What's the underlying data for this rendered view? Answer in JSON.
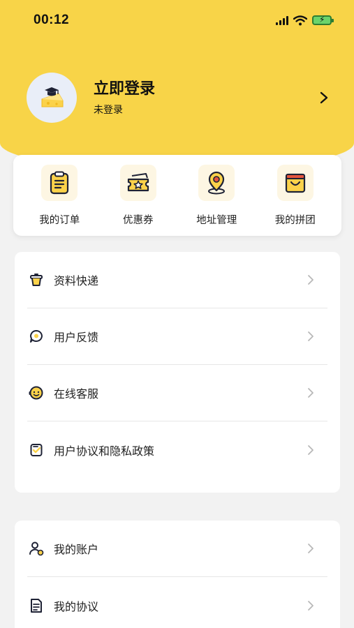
{
  "status_bar": {
    "time": "00:12"
  },
  "profile": {
    "title": "立即登录",
    "subtitle": "未登录"
  },
  "quick_actions": [
    {
      "label": "我的订单",
      "icon": "order-clipboard-icon"
    },
    {
      "label": "优惠券",
      "icon": "coupon-ticket-icon"
    },
    {
      "label": "地址管理",
      "icon": "location-pin-icon"
    },
    {
      "label": "我的拼团",
      "icon": "group-bag-icon"
    }
  ],
  "menu_primary": [
    {
      "label": "资料快递",
      "icon": "cup-icon"
    },
    {
      "label": "用户反馈",
      "icon": "feedback-chat-icon"
    },
    {
      "label": "在线客服",
      "icon": "service-face-icon"
    },
    {
      "label": "用户协议和隐私政策",
      "icon": "agreement-check-icon"
    }
  ],
  "menu_secondary": [
    {
      "label": "我的账户",
      "icon": "account-user-icon"
    },
    {
      "label": "我的协议",
      "icon": "document-icon"
    }
  ],
  "colors": {
    "brand_yellow": "#f8d448",
    "background": "#f2f2f2"
  }
}
